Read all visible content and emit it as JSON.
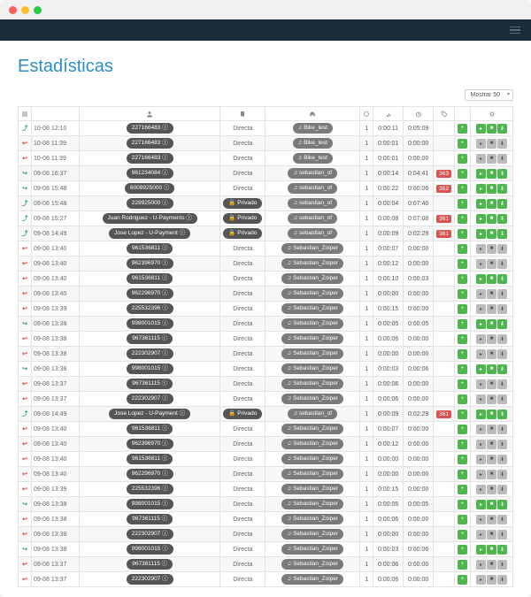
{
  "title": "Estadísticas",
  "show_label": "Mostrar 50",
  "rows": [
    {
      "dir": "fwd",
      "ts": "10-08 12:10",
      "caller": "227166483",
      "info": true,
      "type": "Directa",
      "priv": false,
      "dest": "Bike_test",
      "dest_pill": true,
      "hp": true,
      "c": "1",
      "d1": "0:00:11",
      "d2": "0:05:09",
      "tag": "",
      "ac": "green"
    },
    {
      "dir": "out",
      "ts": "10-08 11:39",
      "caller": "227166483",
      "info": true,
      "type": "Directa",
      "priv": false,
      "dest": "Bike_test",
      "dest_pill": true,
      "hp": true,
      "c": "1",
      "d1": "0:00:01",
      "d2": "0:00:00",
      "tag": "",
      "ac": "gray"
    },
    {
      "dir": "out",
      "ts": "10-08 11:39",
      "caller": "227166483",
      "info": true,
      "type": "Directa",
      "priv": false,
      "dest": "Bike_test",
      "dest_pill": true,
      "hp": true,
      "c": "1",
      "d1": "0:00:01",
      "d2": "0:00:00",
      "tag": "",
      "ac": "gray"
    },
    {
      "dir": "in",
      "ts": "09-08 16:37",
      "caller": "961234084",
      "info": true,
      "type": "Directa",
      "priv": false,
      "dest": "sebastian_of",
      "dest_pill": true,
      "hp": true,
      "c": "1",
      "d1": "0:00:14",
      "d2": "0:04:41",
      "tag": "363",
      "ac": "green"
    },
    {
      "dir": "in",
      "ts": "09-08 15:48",
      "caller": "6008925000",
      "info": true,
      "type": "Directa",
      "priv": false,
      "dest": "sebastian_of",
      "dest_pill": true,
      "hp": true,
      "c": "1",
      "d1": "0:00:22",
      "d2": "0:00:06",
      "tag": "362",
      "ac": "green"
    },
    {
      "dir": "fwd",
      "ts": "09-08 15:48",
      "caller": "228925000",
      "info": true,
      "type": "Privado",
      "priv": true,
      "dest": "sebastian_of",
      "dest_pill": true,
      "hp": true,
      "c": "1",
      "d1": "0:00:04",
      "d2": "0:07:40",
      "tag": "",
      "ac": "green"
    },
    {
      "dir": "fwd",
      "ts": "09-08 15:27",
      "caller": "Juan Rodriguez - U-Payments",
      "info": true,
      "type": "Privado",
      "priv": true,
      "dest": "sebastian_of",
      "dest_pill": true,
      "hp": true,
      "c": "1",
      "d1": "0:00:08",
      "d2": "0:07:08",
      "tag": "361",
      "ac": "green"
    },
    {
      "dir": "fwd",
      "ts": "09-08 14:49",
      "caller": "Jose Lopez - U-Payment",
      "info": true,
      "type": "Privado",
      "priv": true,
      "dest": "sebastian_of",
      "dest_pill": true,
      "hp": true,
      "c": "1",
      "d1": "0:00:09",
      "d2": "0:02:29",
      "tag": "361",
      "ac": "green"
    },
    {
      "dir": "out",
      "ts": "09-08 13:40",
      "caller": "961536811",
      "info": true,
      "type": "Directa",
      "priv": false,
      "dest": "Sebastian_Zoiper",
      "dest_pill": true,
      "hp": true,
      "c": "1",
      "d1": "0:00:07",
      "d2": "0:00:00",
      "tag": "",
      "ac": "gray"
    },
    {
      "dir": "out",
      "ts": "09-08 13:40",
      "caller": "962396970",
      "info": true,
      "type": "Directa",
      "priv": false,
      "dest": "Sebastian_Zoiper",
      "dest_pill": true,
      "hp": true,
      "c": "1",
      "d1": "0:00:12",
      "d2": "0:00:00",
      "tag": "",
      "ac": "gray"
    },
    {
      "dir": "out",
      "ts": "09-08 13:40",
      "caller": "961536811",
      "info": true,
      "type": "Directa",
      "priv": false,
      "dest": "Sebastian_Zoiper",
      "dest_pill": true,
      "hp": true,
      "c": "1",
      "d1": "0:00:10",
      "d2": "0:00:03",
      "tag": "",
      "ac": "green"
    },
    {
      "dir": "out",
      "ts": "09-08 13:40",
      "caller": "962296970",
      "info": true,
      "type": "Directa",
      "priv": false,
      "dest": "Sebastian_Zoiper",
      "dest_pill": true,
      "hp": true,
      "c": "1",
      "d1": "0:00:00",
      "d2": "0:00:00",
      "tag": "",
      "ac": "gray"
    },
    {
      "dir": "out",
      "ts": "09-08 13:39",
      "caller": "225532396",
      "info": true,
      "type": "Directa",
      "priv": false,
      "dest": "Sebastian_Zoiper",
      "dest_pill": true,
      "hp": true,
      "c": "1",
      "d1": "0:00:15",
      "d2": "0:00:00",
      "tag": "",
      "ac": "gray"
    },
    {
      "dir": "in",
      "ts": "09-08 13:38",
      "caller": "998001015",
      "info": true,
      "type": "Directa",
      "priv": false,
      "dest": "Sebastian_Zoiper",
      "dest_pill": true,
      "hp": true,
      "c": "1",
      "d1": "0:00:05",
      "d2": "0:00:05",
      "tag": "",
      "ac": "green"
    },
    {
      "dir": "out",
      "ts": "09-08 13:38",
      "caller": "967361115",
      "info": true,
      "type": "Directa",
      "priv": false,
      "dest": "Sebastian_Zoiper",
      "dest_pill": true,
      "hp": true,
      "c": "1",
      "d1": "0:00:06",
      "d2": "0:00:00",
      "tag": "",
      "ac": "gray"
    },
    {
      "dir": "out",
      "ts": "09-08 13:38",
      "caller": "222302907",
      "info": true,
      "type": "Directa",
      "priv": false,
      "dest": "Sebastian_Zoiper",
      "dest_pill": true,
      "hp": true,
      "c": "1",
      "d1": "0:00:00",
      "d2": "0:00:00",
      "tag": "",
      "ac": "gray"
    },
    {
      "dir": "in",
      "ts": "09-08 13:38",
      "caller": "998001015",
      "info": true,
      "type": "Directa",
      "priv": false,
      "dest": "Sebastian_Zoiper",
      "dest_pill": true,
      "hp": true,
      "c": "1",
      "d1": "0:00:03",
      "d2": "0:00:06",
      "tag": "",
      "ac": "green"
    },
    {
      "dir": "out",
      "ts": "09-08 13:37",
      "caller": "967361115",
      "info": true,
      "type": "Directa",
      "priv": false,
      "dest": "Sebastian_Zoiper",
      "dest_pill": true,
      "hp": true,
      "c": "1",
      "d1": "0:00:06",
      "d2": "0:00:00",
      "tag": "",
      "ac": "gray"
    },
    {
      "dir": "out",
      "ts": "09-08 13:37",
      "caller": "222302907",
      "info": true,
      "type": "Directa",
      "priv": false,
      "dest": "Sebastian_Zoiper",
      "dest_pill": true,
      "hp": true,
      "c": "1",
      "d1": "0:00:06",
      "d2": "0:00:00",
      "tag": "",
      "ac": "gray"
    },
    {
      "dir": "fwd",
      "ts": "09-08 14:49",
      "caller": "Jose Lopez - U-Payment",
      "info": true,
      "type": "Privado",
      "priv": true,
      "dest": "sebastian_of",
      "dest_pill": true,
      "hp": true,
      "c": "1",
      "d1": "0:00:09",
      "d2": "0:02:29",
      "tag": "361",
      "ac": "green"
    },
    {
      "dir": "out",
      "ts": "09-08 13:40",
      "caller": "961536811",
      "info": true,
      "type": "Directa",
      "priv": false,
      "dest": "Sebastian_Zoiper",
      "dest_pill": true,
      "hp": true,
      "c": "1",
      "d1": "0:00:07",
      "d2": "0:00:00",
      "tag": "",
      "ac": "gray"
    },
    {
      "dir": "out",
      "ts": "09-08 13:40",
      "caller": "962396970",
      "info": true,
      "type": "Directa",
      "priv": false,
      "dest": "Sebastian_Zoiper",
      "dest_pill": true,
      "hp": true,
      "c": "1",
      "d1": "0:00:12",
      "d2": "0:00:00",
      "tag": "",
      "ac": "gray"
    },
    {
      "dir": "out",
      "ts": "09-08 13:40",
      "caller": "961536811",
      "info": true,
      "type": "Directa",
      "priv": false,
      "dest": "Sebastian_Zoiper",
      "dest_pill": true,
      "hp": true,
      "c": "1",
      "d1": "0:00:00",
      "d2": "0:00:00",
      "tag": "",
      "ac": "gray"
    },
    {
      "dir": "out",
      "ts": "09-08 13:40",
      "caller": "962296970",
      "info": true,
      "type": "Directa",
      "priv": false,
      "dest": "Sebastian_Zoiper",
      "dest_pill": true,
      "hp": true,
      "c": "1",
      "d1": "0:00:00",
      "d2": "0:00:00",
      "tag": "",
      "ac": "gray"
    },
    {
      "dir": "out",
      "ts": "09-08 13:39",
      "caller": "225532396",
      "info": true,
      "type": "Directa",
      "priv": false,
      "dest": "Sebastian_Zoiper",
      "dest_pill": true,
      "hp": true,
      "c": "1",
      "d1": "0:00:15",
      "d2": "0:00:00",
      "tag": "",
      "ac": "gray"
    },
    {
      "dir": "in",
      "ts": "09-08 13:38",
      "caller": "998001015",
      "info": true,
      "type": "Directa",
      "priv": false,
      "dest": "Sebastian_Zoiper",
      "dest_pill": true,
      "hp": true,
      "c": "1",
      "d1": "0:00:05",
      "d2": "0:00:05",
      "tag": "",
      "ac": "green"
    },
    {
      "dir": "out",
      "ts": "09-08 13:38",
      "caller": "967361115",
      "info": true,
      "type": "Directa",
      "priv": false,
      "dest": "Sebastian_Zoiper",
      "dest_pill": true,
      "hp": true,
      "c": "1",
      "d1": "0:00:06",
      "d2": "0:00:00",
      "tag": "",
      "ac": "gray"
    },
    {
      "dir": "out",
      "ts": "09-08 13:38",
      "caller": "222302907",
      "info": true,
      "type": "Directa",
      "priv": false,
      "dest": "Sebastian_Zoiper",
      "dest_pill": true,
      "hp": true,
      "c": "1",
      "d1": "0:00:00",
      "d2": "0:00:00",
      "tag": "",
      "ac": "gray"
    },
    {
      "dir": "in",
      "ts": "09-08 13:38",
      "caller": "998001015",
      "info": true,
      "type": "Directa",
      "priv": false,
      "dest": "Sebastian_Zoiper",
      "dest_pill": true,
      "hp": true,
      "c": "1",
      "d1": "0:00:03",
      "d2": "0:00:06",
      "tag": "",
      "ac": "green"
    },
    {
      "dir": "out",
      "ts": "09-08 13:37",
      "caller": "967361115",
      "info": true,
      "type": "Directa",
      "priv": false,
      "dest": "Sebastian_Zoiper",
      "dest_pill": true,
      "hp": true,
      "c": "1",
      "d1": "0:00:06",
      "d2": "0:00:00",
      "tag": "",
      "ac": "gray"
    },
    {
      "dir": "out",
      "ts": "09-08 13:37",
      "caller": "222302907",
      "info": true,
      "type": "Directa",
      "priv": false,
      "dest": "Sebastian_Zoiper",
      "dest_pill": true,
      "hp": true,
      "c": "1",
      "d1": "0:00:06",
      "d2": "0:00:00",
      "tag": "",
      "ac": "gray"
    }
  ]
}
